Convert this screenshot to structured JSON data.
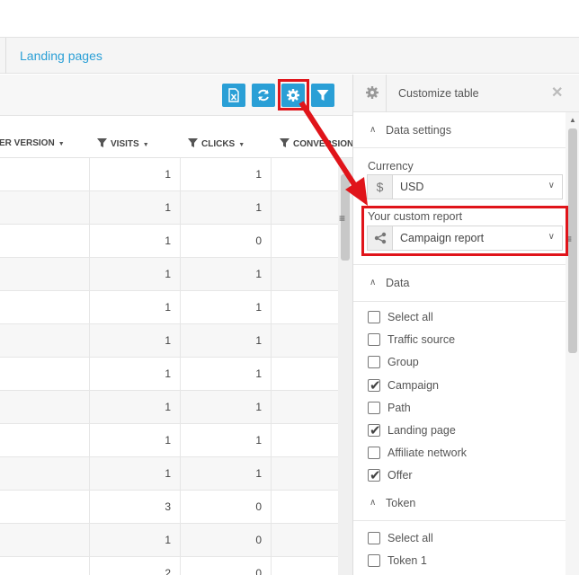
{
  "tabs": [
    {
      "label": "Landing pages"
    }
  ],
  "toolbar": {
    "buttons": [
      {
        "icon": "excel-export-icon"
      },
      {
        "icon": "refresh-icon"
      },
      {
        "icon": "gear-icon"
      },
      {
        "icon": "filter-icon"
      }
    ]
  },
  "table": {
    "columns": [
      {
        "label": "ER VERSION"
      },
      {
        "label": "VISITS"
      },
      {
        "label": "CLICKS"
      },
      {
        "label": "CONVERSION"
      }
    ],
    "rows": [
      {
        "visits": "1",
        "clicks": "1"
      },
      {
        "visits": "1",
        "clicks": "1"
      },
      {
        "visits": "1",
        "clicks": "0"
      },
      {
        "visits": "1",
        "clicks": "1"
      },
      {
        "visits": "1",
        "clicks": "1"
      },
      {
        "visits": "1",
        "clicks": "1"
      },
      {
        "visits": "1",
        "clicks": "1"
      },
      {
        "visits": "1",
        "clicks": "1"
      },
      {
        "visits": "1",
        "clicks": "1"
      },
      {
        "visits": "1",
        "clicks": "1"
      },
      {
        "visits": "3",
        "clicks": "0"
      },
      {
        "visits": "1",
        "clicks": "0"
      },
      {
        "visits": "2",
        "clicks": "0"
      }
    ]
  },
  "panel": {
    "title": "Customize table",
    "data_settings": {
      "title": "Data settings",
      "currency_label": "Currency",
      "currency_symbol": "$",
      "currency_value": "USD",
      "report_label": "Your custom report",
      "report_value": "Campaign report"
    },
    "data": {
      "title": "Data",
      "items": [
        {
          "label": "Select all",
          "checked": false
        },
        {
          "label": "Traffic source",
          "checked": false
        },
        {
          "label": "Group",
          "checked": false
        },
        {
          "label": "Campaign",
          "checked": true
        },
        {
          "label": "Path",
          "checked": false
        },
        {
          "label": "Landing page",
          "checked": true
        },
        {
          "label": "Affiliate network",
          "checked": false
        },
        {
          "label": "Offer",
          "checked": true
        }
      ]
    },
    "token": {
      "title": "Token",
      "items": [
        {
          "label": "Select all",
          "checked": false
        },
        {
          "label": "Token 1",
          "checked": false
        }
      ]
    }
  },
  "colors": {
    "accent": "#2a9fd6",
    "highlight": "#e0141a"
  }
}
